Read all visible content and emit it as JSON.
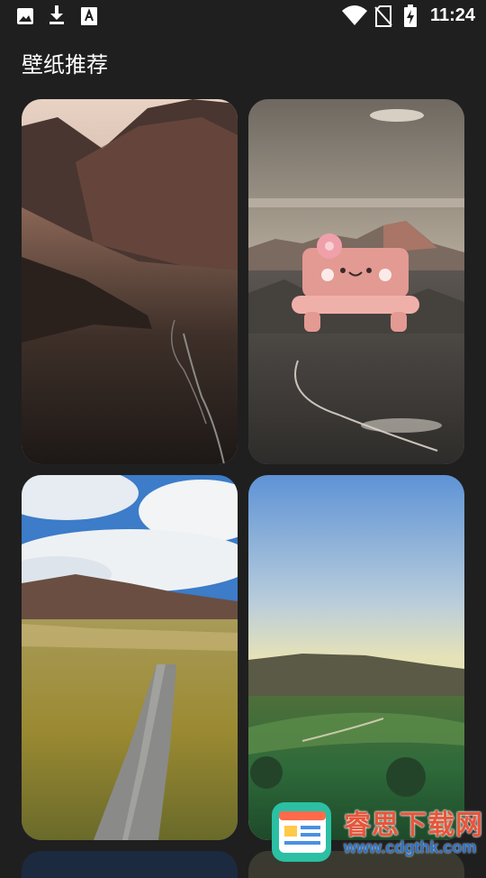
{
  "status_bar": {
    "time": "11:24",
    "left_icons": [
      "image-icon",
      "download-icon",
      "font-a-icon"
    ],
    "right_icons": [
      "wifi-icon",
      "no-sim-icon",
      "battery-charging-icon"
    ]
  },
  "header": {
    "title": "壁纸推荐"
  },
  "wallpapers": [
    {
      "scene": "mountain-valley-dusk"
    },
    {
      "scene": "desert-mountains-with-pink-bench-sticker"
    },
    {
      "scene": "grassland-road-blue-sky"
    },
    {
      "scene": "green-hills-sunrise"
    }
  ],
  "watermark": {
    "text": "睿思下载网",
    "url": "www.cdgthk.com"
  }
}
